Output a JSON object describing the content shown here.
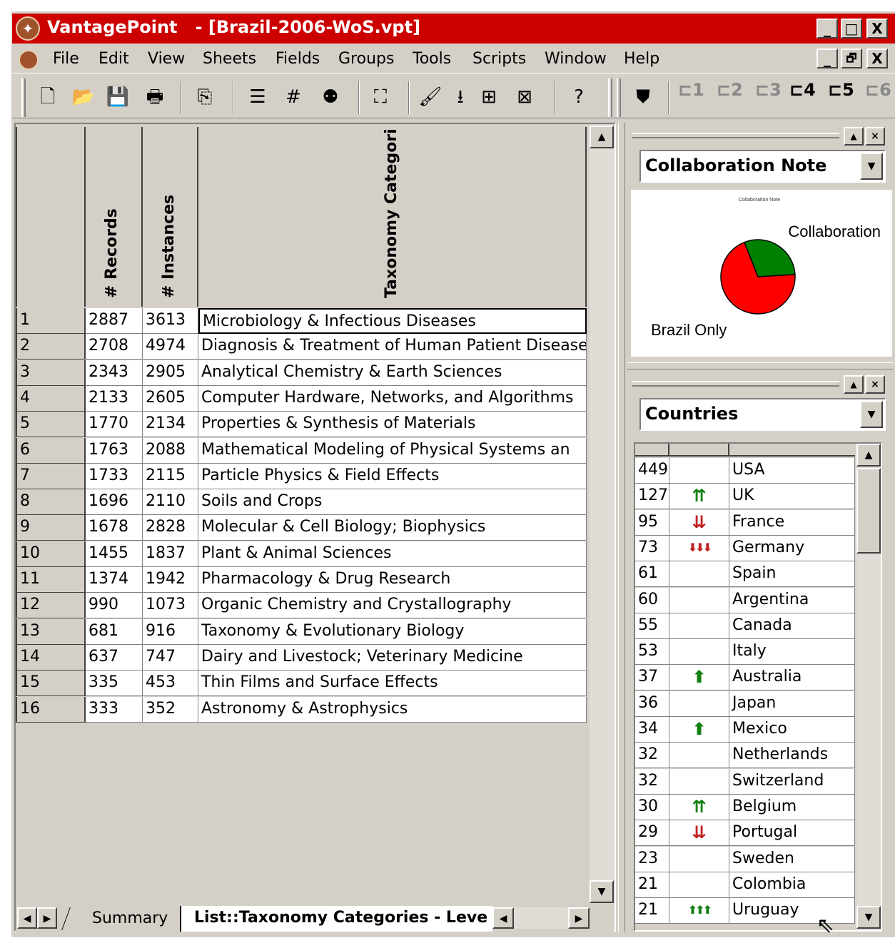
{
  "window": {
    "app_name": "VantagePoint",
    "title": "VantagePoint   - [Brazil-2006-WoS.vpt]",
    "min": "_",
    "max": "□",
    "close": "X",
    "restore": "🗗"
  },
  "menu": [
    "File",
    "Edit",
    "View",
    "Sheets",
    "Fields",
    "Groups",
    "Tools",
    "Scripts",
    "Window",
    "Help"
  ],
  "toolbar": {
    "numbered": [
      "1",
      "2",
      "3",
      "4",
      "5",
      "6"
    ]
  },
  "grid": {
    "headers": {
      "records": "# Records",
      "instances": "# Instances",
      "category": "Taxonomy Categori"
    },
    "rows": [
      {
        "n": "1",
        "records": "2887",
        "instances": "3613",
        "category": "Microbiology & Infectious Diseases"
      },
      {
        "n": "2",
        "records": "2708",
        "instances": "4974",
        "category": "Diagnosis & Treatment of Human Patient Disease"
      },
      {
        "n": "3",
        "records": "2343",
        "instances": "2905",
        "category": "Analytical Chemistry & Earth Sciences"
      },
      {
        "n": "4",
        "records": "2133",
        "instances": "2605",
        "category": "Computer Hardware, Networks, and Algorithms"
      },
      {
        "n": "5",
        "records": "1770",
        "instances": "2134",
        "category": "Properties & Synthesis of Materials"
      },
      {
        "n": "6",
        "records": "1763",
        "instances": "2088",
        "category": "Mathematical Modeling of Physical Systems an"
      },
      {
        "n": "7",
        "records": "1733",
        "instances": "2115",
        "category": "Particle Physics & Field Effects"
      },
      {
        "n": "8",
        "records": "1696",
        "instances": "2110",
        "category": "Soils and Crops"
      },
      {
        "n": "9",
        "records": "1678",
        "instances": "2828",
        "category": "Molecular & Cell Biology; Biophysics"
      },
      {
        "n": "10",
        "records": "1455",
        "instances": "1837",
        "category": "Plant & Animal Sciences"
      },
      {
        "n": "11",
        "records": "1374",
        "instances": "1942",
        "category": "Pharmacology & Drug Research"
      },
      {
        "n": "12",
        "records": "990",
        "instances": "1073",
        "category": "Organic Chemistry and Crystallography"
      },
      {
        "n": "13",
        "records": "681",
        "instances": "916",
        "category": "Taxonomy & Evolutionary Biology"
      },
      {
        "n": "14",
        "records": "637",
        "instances": "747",
        "category": "Dairy and Livestock; Veterinary Medicine"
      },
      {
        "n": "15",
        "records": "335",
        "instances": "453",
        "category": "Thin Films and Surface Effects"
      },
      {
        "n": "16",
        "records": "333",
        "instances": "352",
        "category": "Astronomy & Astrophysics"
      }
    ]
  },
  "tabs": {
    "summary": "Summary",
    "list": "List::Taxonomy Categories - Leve"
  },
  "collab_panel": {
    "selector": "Collaboration Note",
    "mini_title": "Collaboration Note",
    "label_collab": "Collaboration",
    "label_brazil": "Brazil Only"
  },
  "chart_data": {
    "type": "pie",
    "title": "Collaboration Note",
    "categories": [
      "Collaboration",
      "Brazil Only"
    ],
    "values": [
      30,
      70
    ],
    "colors": [
      "#008000",
      "#ff0000"
    ]
  },
  "countries_panel": {
    "selector": "Countries",
    "rows": [
      {
        "count": "449",
        "trend": "",
        "name": "USA"
      },
      {
        "count": "127",
        "trend": "up2",
        "name": "UK"
      },
      {
        "count": "95",
        "trend": "down2",
        "name": "France"
      },
      {
        "count": "73",
        "trend": "down3",
        "name": "Germany"
      },
      {
        "count": "61",
        "trend": "",
        "name": "Spain"
      },
      {
        "count": "60",
        "trend": "",
        "name": "Argentina"
      },
      {
        "count": "55",
        "trend": "",
        "name": "Canada"
      },
      {
        "count": "53",
        "trend": "",
        "name": "Italy"
      },
      {
        "count": "37",
        "trend": "up1",
        "name": "Australia"
      },
      {
        "count": "36",
        "trend": "",
        "name": "Japan"
      },
      {
        "count": "34",
        "trend": "up1",
        "name": "Mexico"
      },
      {
        "count": "32",
        "trend": "",
        "name": "Netherlands"
      },
      {
        "count": "32",
        "trend": "",
        "name": "Switzerland"
      },
      {
        "count": "30",
        "trend": "up2",
        "name": "Belgium"
      },
      {
        "count": "29",
        "trend": "down2",
        "name": "Portugal"
      },
      {
        "count": "23",
        "trend": "",
        "name": "Sweden"
      },
      {
        "count": "21",
        "trend": "",
        "name": "Colombia"
      },
      {
        "count": "21",
        "trend": "up3",
        "name": "Uruguay"
      }
    ]
  },
  "colors": {
    "titlebar": "#cd0000",
    "face": "#d4d0c8",
    "up": "#108010",
    "down": "#c02020"
  }
}
